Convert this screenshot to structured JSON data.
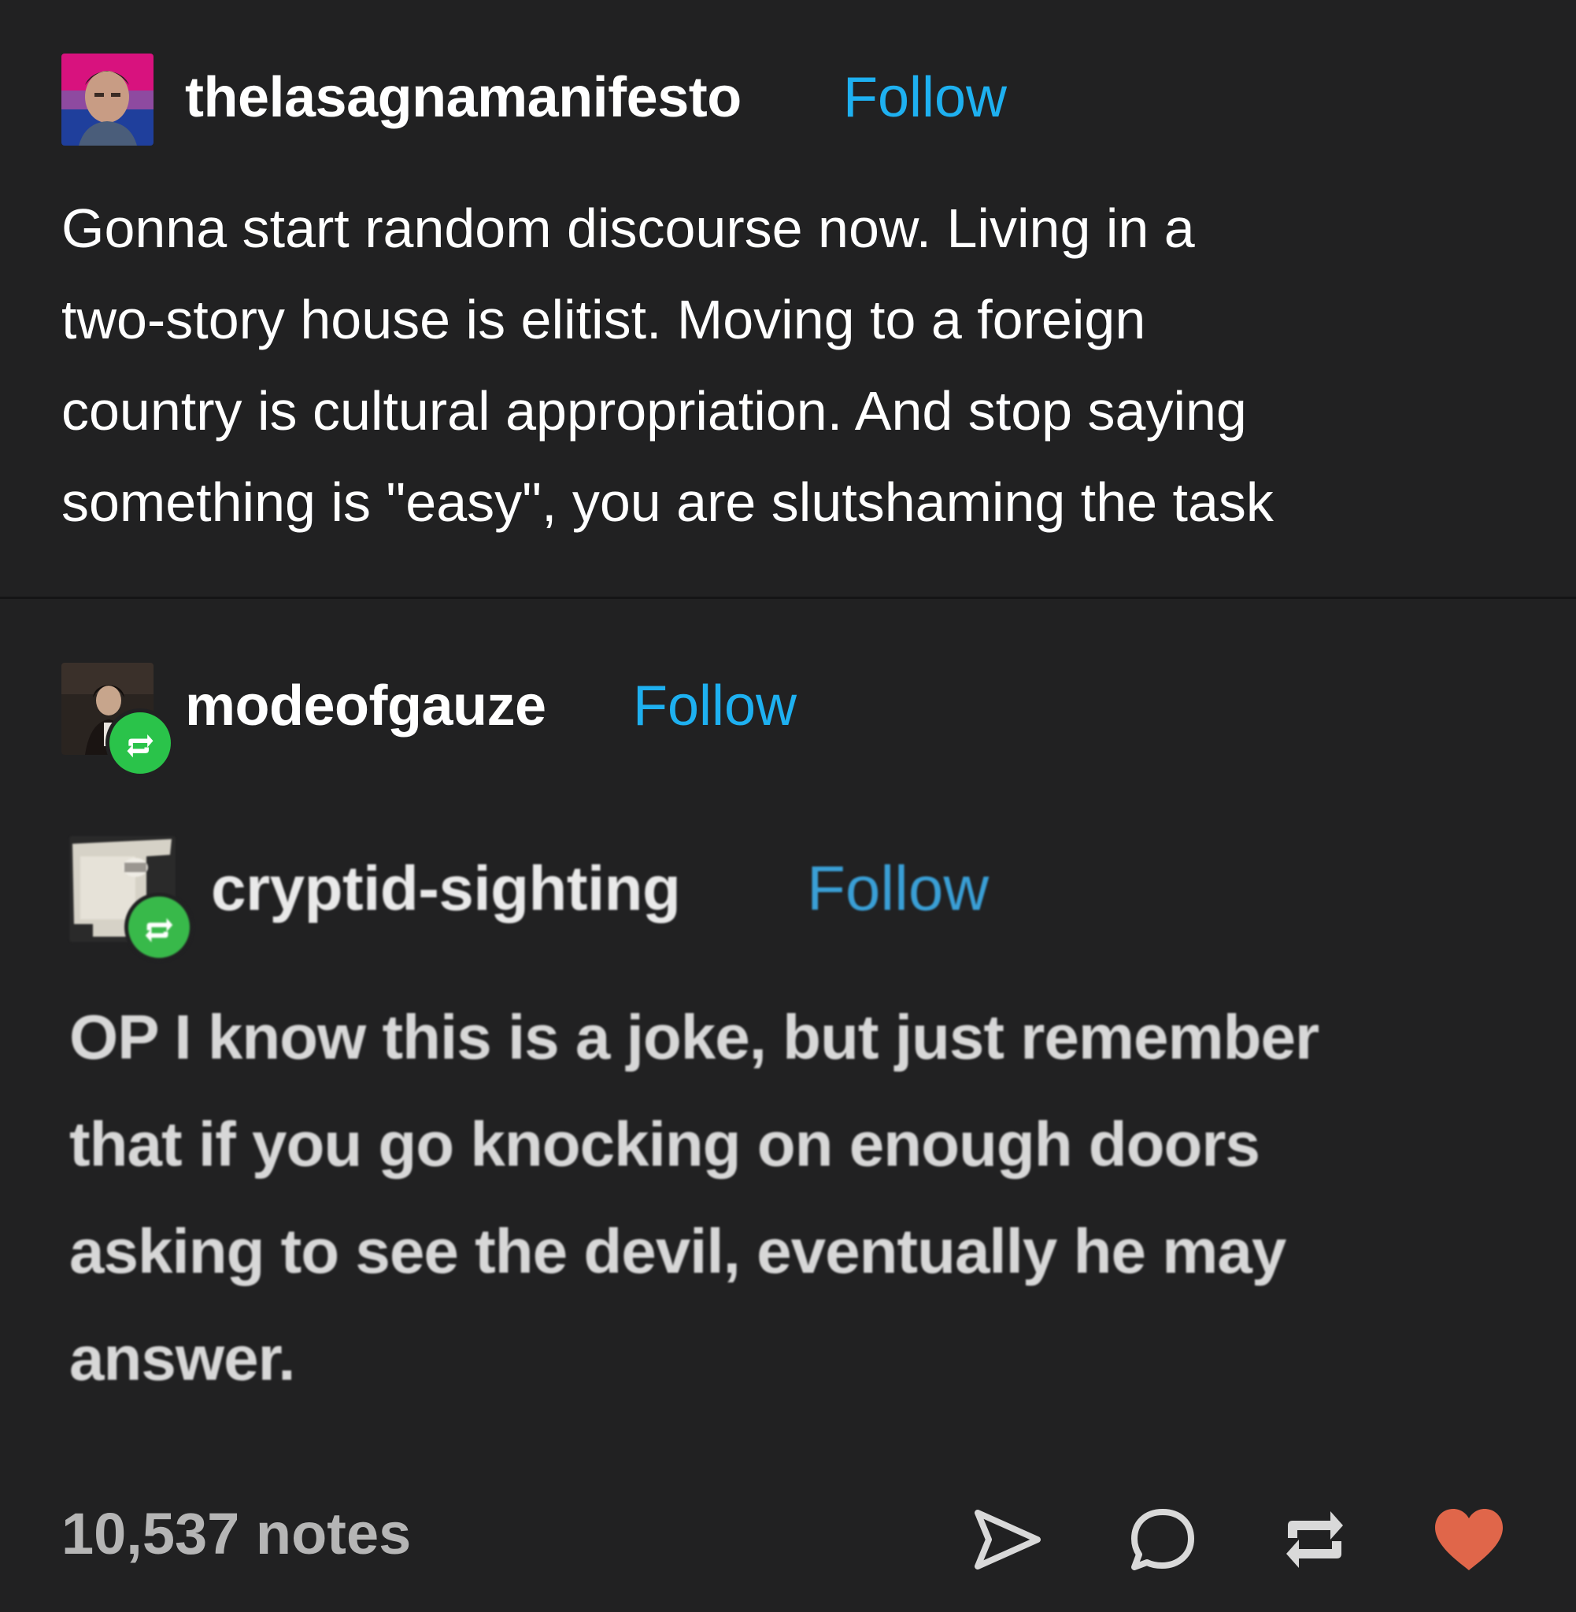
{
  "posts": [
    {
      "username": "thelasagnamanifesto",
      "follow_label": "Follow",
      "lines": [
        "Gonna start random discourse now. Living in a",
        "two-story house is elitist. Moving to a foreign",
        "country is cultural appropriation. And stop saying",
        "something is \"easy\", you are slutshaming the task"
      ]
    },
    {
      "username": "modeofgauze",
      "follow_label": "Follow"
    },
    {
      "username": "cryptid-sighting",
      "follow_label": "Follow",
      "lines": [
        "OP I know this is a joke, but just remember",
        "that if you go knocking on enough doors",
        "asking to see the devil, eventually he may",
        "answer."
      ]
    }
  ],
  "footer": {
    "notes": "10,537 notes",
    "actions": [
      "share-icon",
      "comment-icon",
      "reblog-icon",
      "like-icon"
    ]
  },
  "colors": {
    "background": "#212122",
    "follow": "#1eb0f0",
    "reblog_badge": "#2ac34a",
    "heart": "#e0664a"
  }
}
